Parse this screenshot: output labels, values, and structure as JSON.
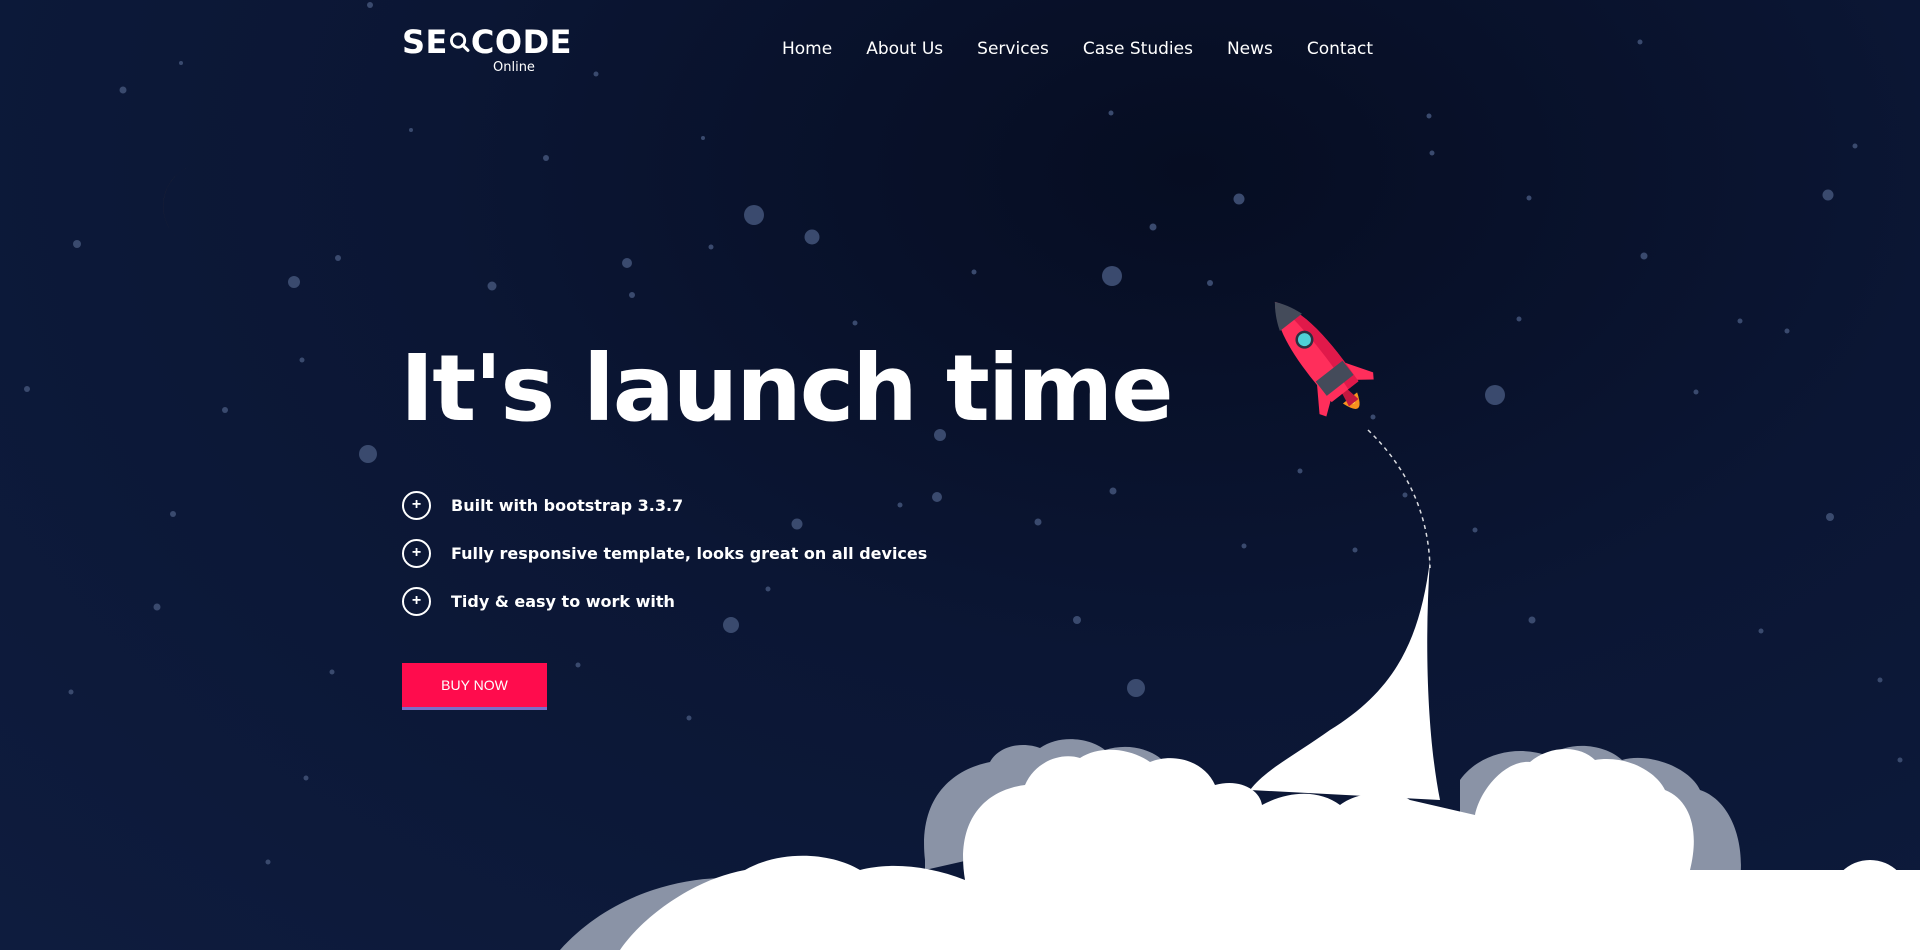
{
  "brand": {
    "name_left": "SE",
    "name_right": "CODE",
    "tagline": "Online"
  },
  "nav": {
    "items": [
      "Home",
      "About Us",
      "Services",
      "Case Studies",
      "News",
      "Contact"
    ]
  },
  "hero": {
    "headline": "It's launch time",
    "features": [
      "Built with bootstrap 3.3.7",
      "Fully responsive template, looks great on all devices",
      "Tidy & easy to work with"
    ],
    "cta_label": "BUY NOW"
  },
  "colors": {
    "background": "#0b1634",
    "accent": "#ff0c4d",
    "moon": "#f7931e",
    "rocket": "#ff2e5b",
    "cloud": "#ffffff",
    "cloud_shadow": "#8a93a6"
  },
  "icons": [
    "magnifier-logo-icon",
    "plus-circle-icon",
    "moon-icon",
    "rocket-icon"
  ]
}
